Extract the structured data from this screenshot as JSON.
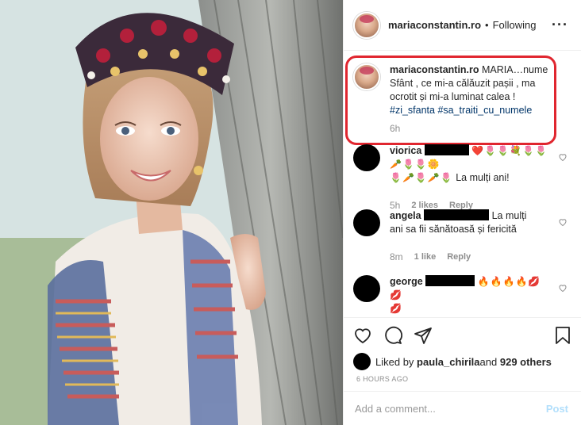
{
  "header": {
    "username": "mariaconstantin.ro",
    "separator": "•",
    "follow_status": "Following",
    "more_icon": "more-horizontal-icon",
    "more_glyph": "···"
  },
  "caption": {
    "username": "mariaconstantin.ro",
    "text": "MARIA…nume Sfânt , ce mi-a călăuzit pașii , ma ocrotit și mi-a luminat calea !",
    "hashtags": "#zi_sfanta #sa_traiti_cu_numele",
    "time": "6h"
  },
  "comments": [
    {
      "username": "viorica",
      "emoji": "❤️🌷🌷💐🌷🌷🥕🌷🌷🌼",
      "emoji2": "🌷🥕🌷🥕🌷",
      "text": "La mulți ani!",
      "time": "5h",
      "likes": "2 likes",
      "reply": "Reply"
    },
    {
      "username": "angela",
      "text_inline": "La mulți",
      "text": "ani sa fii sănătoasă și fericită",
      "time": "8m",
      "likes": "1 like",
      "reply": "Reply"
    },
    {
      "username": "george",
      "emoji": "🔥🔥🔥🔥💋💋",
      "emoji2": "💋"
    }
  ],
  "likes": {
    "prefix": "Liked by ",
    "user": "paula_chirila",
    "middle": " and ",
    "count": "929 others"
  },
  "timestamp": "6 HOURS AGO",
  "add_comment": {
    "placeholder": "Add a comment...",
    "post_label": "Post"
  },
  "colors": {
    "highlight_box": "#e0262f",
    "hashtag": "#003569",
    "post_button": "#b2dffc",
    "muted": "#8e8e8e"
  }
}
